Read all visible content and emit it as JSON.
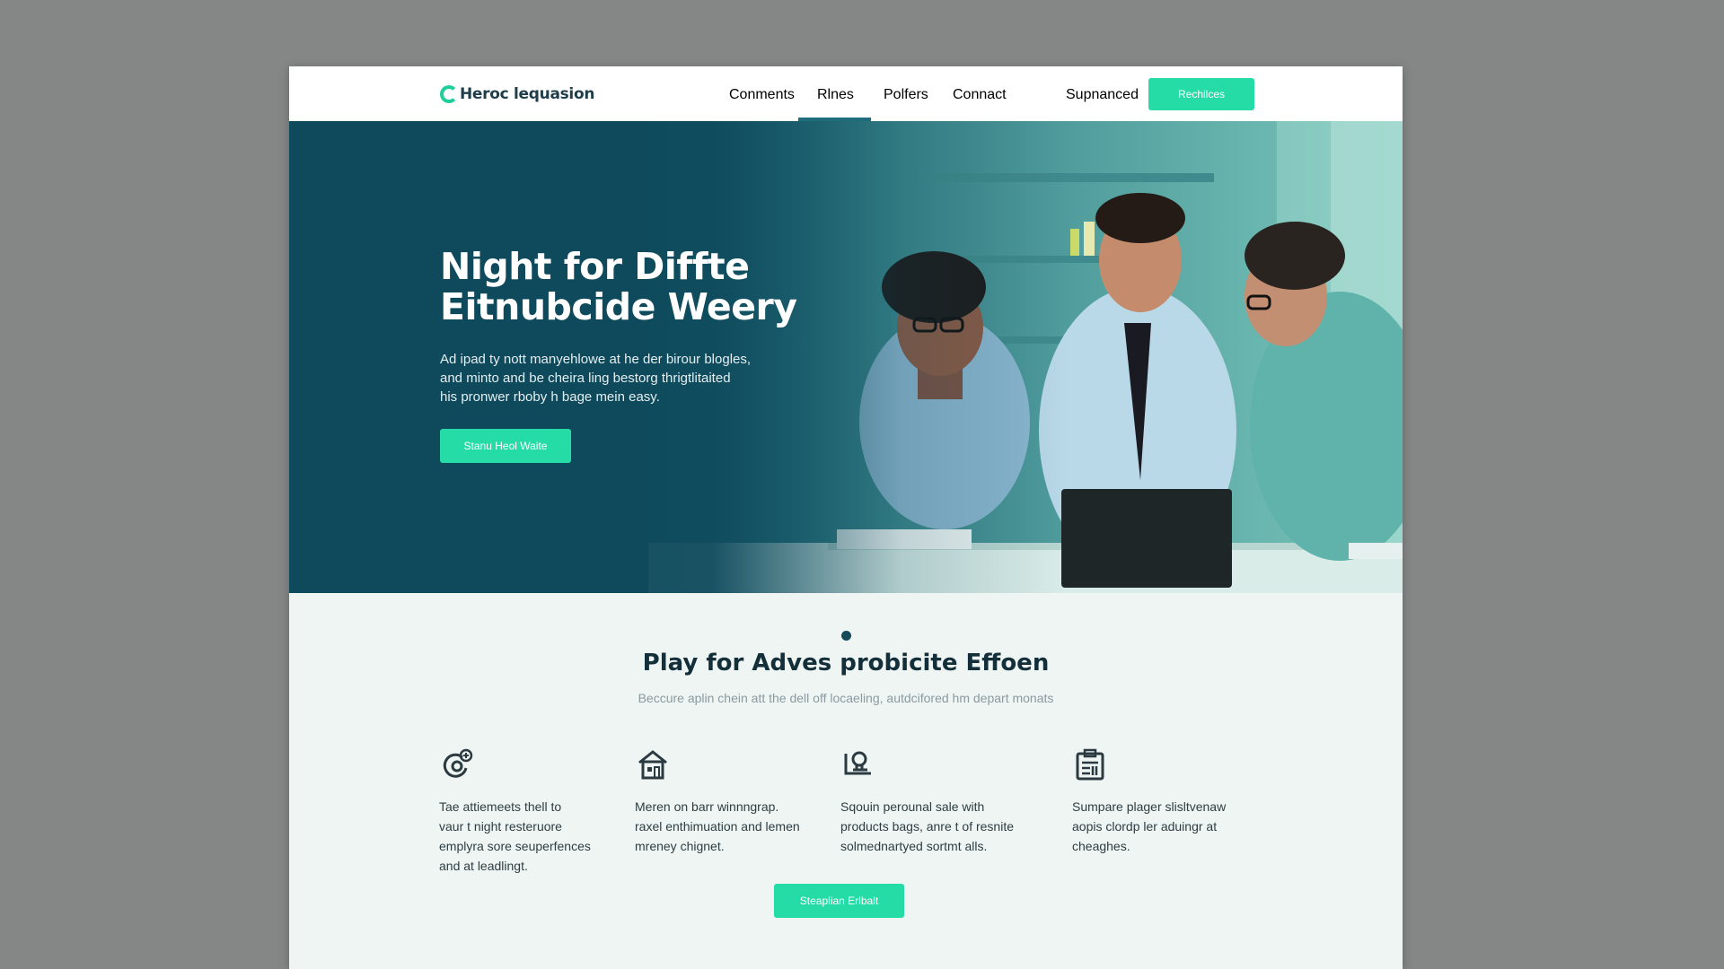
{
  "header": {
    "logo_text": "Heroc lequasion",
    "nav": [
      "Conments",
      "Rlnes",
      "Polfers",
      "Connact",
      "Supnanced"
    ],
    "cta_label": "Rechilces"
  },
  "hero": {
    "title_line1": "Night for Diffte",
    "title_line2": "Eitnubcide Weery",
    "text_lines": [
      "Ad ipad ty nott manyehlowe at he der birour blogles,",
      "and minto and be cheira ling bestorg thrigtlitaited",
      "his pronwer rboby h bage mein easy."
    ],
    "cta_label": "Stanu Heol Waite"
  },
  "features_section": {
    "title": "Play for Adves probicite Effoen",
    "subtitle": "Beccure aplin chein att the dell off locaeling, autdcifored hm depart monats",
    "items": [
      {
        "icon": "refresh-plus-icon",
        "lines": [
          "Tae attiemeets thell to",
          "vaur t night resteruore",
          "emplyra sore seuperfences",
          "and at leadlingt."
        ]
      },
      {
        "icon": "house-icon",
        "lines": [
          "Meren on barr winnngrap.",
          "raxel enthimuation and lemen",
          "mreney chignet."
        ]
      },
      {
        "icon": "stamp-icon",
        "lines": [
          "Sqouin perounal sale with",
          "products bags, anre t of resnite",
          "solmednartyed sortmt alls."
        ]
      },
      {
        "icon": "clipboard-icon",
        "lines": [
          "Sumpare plager slisltvenaw",
          "aopis clordp ler aduingr at",
          "cheaghes."
        ]
      }
    ],
    "cta_label": "Steaplian Erlbalt"
  },
  "colors": {
    "accent": "#25dca6",
    "hero_dark": "#0e4a5c",
    "heading": "#13303a",
    "nav_active": "#1f6d7c"
  }
}
